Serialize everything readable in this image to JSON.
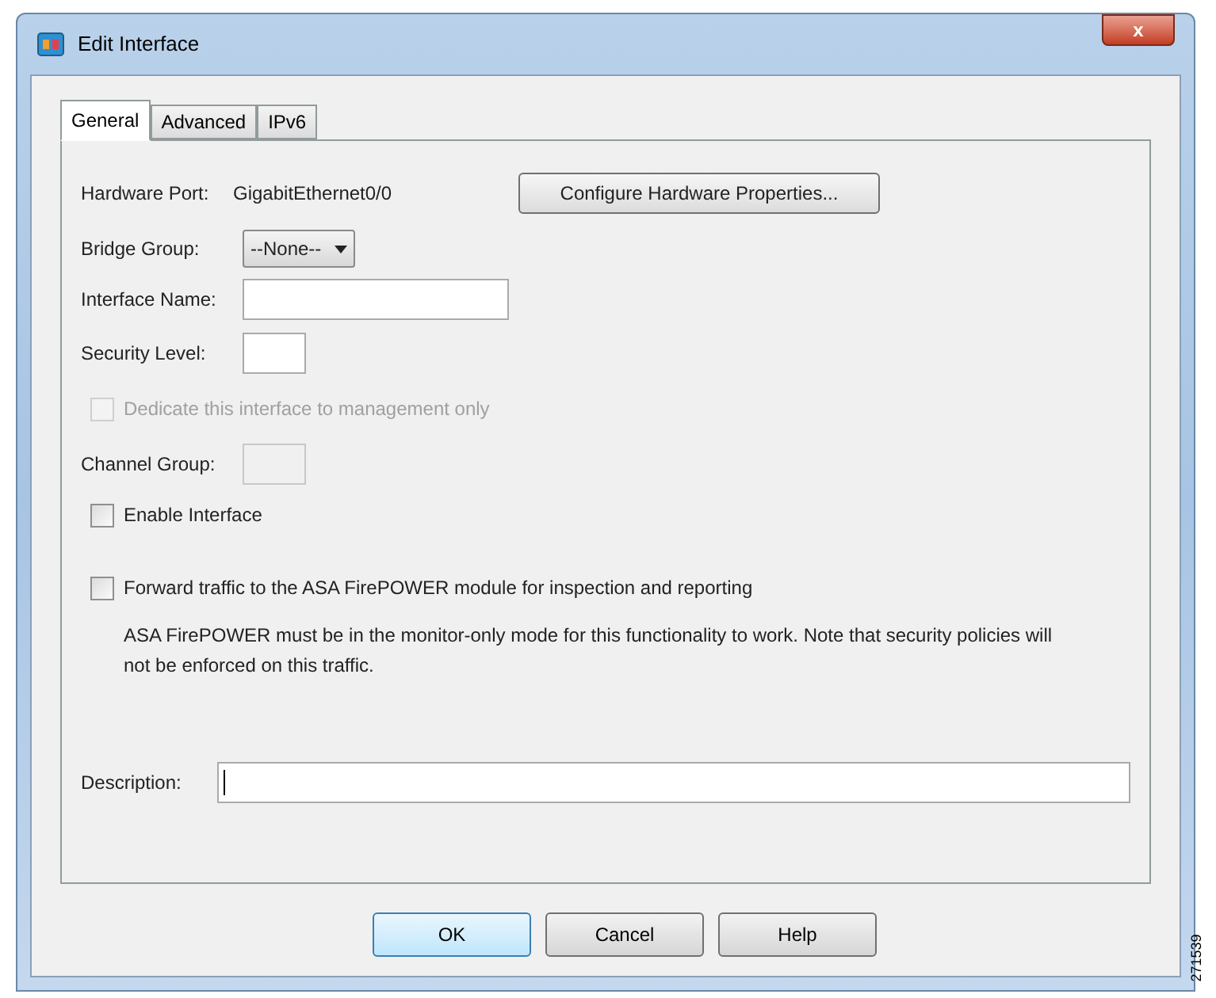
{
  "window": {
    "title": "Edit Interface",
    "close": "x"
  },
  "tabs": [
    {
      "label": "General",
      "selected": true
    },
    {
      "label": "Advanced",
      "selected": false
    },
    {
      "label": "IPv6",
      "selected": false
    }
  ],
  "hardware_port": {
    "label": "Hardware Port:",
    "value": "GigabitEthernet0/0",
    "button": "Configure Hardware Properties..."
  },
  "bridge_group": {
    "label": "Bridge Group:",
    "value": "--None--"
  },
  "interface_name": {
    "label": "Interface Name:",
    "disabled": false
  },
  "security_level": {
    "label": "Security Level:",
    "disabled": false
  },
  "management_only": {
    "label": "Dedicate this interface to management only",
    "checked": false,
    "disabled": true
  },
  "channel_group": {
    "label": "Channel Group:",
    "disabled": true
  },
  "enable_interface": {
    "label": "Enable Interface",
    "checked": false,
    "disabled": false
  },
  "forward_traffic": {
    "label": "Forward traffic to the ASA FirePOWER module for inspection and reporting",
    "checked": false,
    "disabled": false
  },
  "note": "ASA FirePOWER must be in the monitor-only mode for this functionality to work. Note that security policies will not be enforced on this traffic.",
  "description": {
    "label": "Description:",
    "focused": true
  },
  "buttons": [
    {
      "label": "OK",
      "default": true
    },
    {
      "label": "Cancel",
      "default": false
    },
    {
      "label": "Help",
      "default": false
    }
  ],
  "figure_id": "271539"
}
